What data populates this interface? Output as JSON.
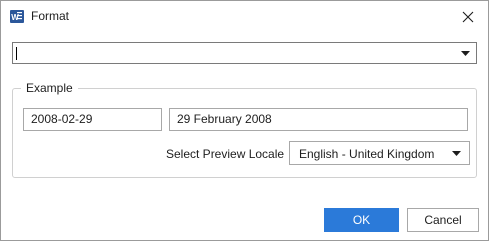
{
  "window": {
    "title": "Format",
    "icon": "word-icon",
    "close_icon": "close-icon"
  },
  "format_combo": {
    "value": "",
    "arrow_icon": "dropdown-arrow-icon"
  },
  "example": {
    "label": "Example",
    "short_date": "2008-02-29",
    "long_date": "29 February 2008",
    "locale_label": "Select Preview Locale",
    "locale_value": "English - United Kingdom"
  },
  "buttons": {
    "ok": "OK",
    "cancel": "Cancel"
  },
  "colors": {
    "accent": "#2b7ad9",
    "word_icon": "#2b579a"
  }
}
